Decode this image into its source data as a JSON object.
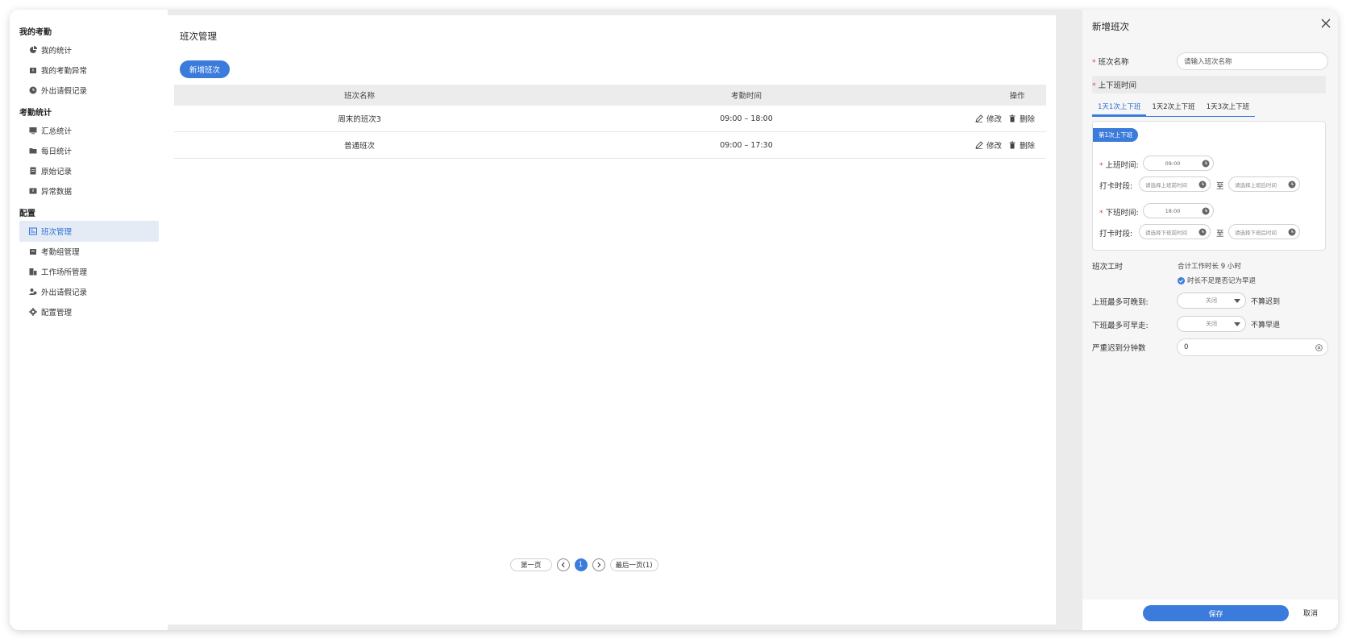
{
  "sidebar": {
    "groups": [
      {
        "title": "我的考勤",
        "items": [
          {
            "label": "我的统计",
            "icon": "pie-chart-icon"
          },
          {
            "label": "我的考勤异常",
            "icon": "calendar-alert-icon"
          },
          {
            "label": "外出请假记录",
            "icon": "clock-icon"
          }
        ]
      },
      {
        "title": "考勤统计",
        "items": [
          {
            "label": "汇总统计",
            "icon": "monitor-icon"
          },
          {
            "label": "每日统计",
            "icon": "folder-icon"
          },
          {
            "label": "原始记录",
            "icon": "document-icon"
          },
          {
            "label": "异常数据",
            "icon": "alert-icon"
          }
        ]
      },
      {
        "title": "配置",
        "items": [
          {
            "label": "班次管理",
            "icon": "schedule-icon",
            "active": true
          },
          {
            "label": "考勤组管理",
            "icon": "group-box-icon"
          },
          {
            "label": "工作场所管理",
            "icon": "building-icon"
          },
          {
            "label": "外出请假记录",
            "icon": "users-icon"
          },
          {
            "label": "配置管理",
            "icon": "gear-icon"
          }
        ]
      }
    ]
  },
  "main": {
    "title": "班次管理",
    "add_button": "新增班次",
    "table": {
      "headers": [
        "班次名称",
        "考勤时间",
        "操作"
      ],
      "rows": [
        {
          "name": "周末的班次3",
          "time": "09:00 – 18:00",
          "edit": "修改",
          "delete": "删除"
        },
        {
          "name": "普通班次",
          "time": "09:00 – 17:30",
          "edit": "修改",
          "delete": "删除"
        }
      ]
    },
    "pager": {
      "first": "第一页",
      "current": "1",
      "last": "最后一页(1)"
    }
  },
  "panel": {
    "title": "新增班次",
    "name_label": "班次名称",
    "name_placeholder": "请输入班次名称",
    "shift_time_label": "上下班时间",
    "tabs": [
      "1天1次上下班",
      "1天2次上下班",
      "1天3次上下班"
    ],
    "chip": "第1次上下班",
    "start_label": "上班时间:",
    "start_value": "09:00",
    "punch_label": "打卡时段:",
    "before_start_ph": "请选择上班前时间",
    "to": "至",
    "after_start_ph": "请选择上班后时间",
    "end_label": "下班时间:",
    "end_value": "18:00",
    "before_end_ph": "请选择下班前时间",
    "after_end_ph": "请选择下班后时间",
    "work_hours_label": "班次工时",
    "work_hours_value": "合计工作时长 9 小时",
    "early_check": "时长不足是否记为早退",
    "late_label": "上班最多可晚到:",
    "late_value": "关闭",
    "late_suffix": "不算迟到",
    "early_label": "下班最多可早走:",
    "early_value": "关闭",
    "early_suffix": "不算早退",
    "severe_label": "严重迟到分钟数",
    "severe_value": "0",
    "save": "保存",
    "cancel": "取消",
    "accent": "#3a7bdb"
  }
}
